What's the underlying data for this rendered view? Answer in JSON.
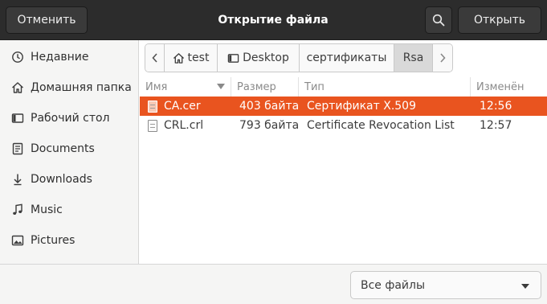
{
  "header": {
    "cancel_label": "Отменить",
    "title": "Открытие файла",
    "open_label": "Открыть",
    "search_icon": "search-icon"
  },
  "sidebar": {
    "items": [
      {
        "label": "Недавние",
        "icon": "clock-icon"
      },
      {
        "label": "Домашняя папка",
        "icon": "home-icon"
      },
      {
        "label": "Рабочий стол",
        "icon": "desktop-icon"
      },
      {
        "label": "Documents",
        "icon": "document-icon"
      },
      {
        "label": "Downloads",
        "icon": "download-icon"
      },
      {
        "label": "Music",
        "icon": "music-icon"
      },
      {
        "label": "Pictures",
        "icon": "picture-icon"
      }
    ]
  },
  "pathbar": {
    "crumbs": [
      {
        "label": "test",
        "icon": "home-icon"
      },
      {
        "label": "Desktop",
        "icon": "desktop-icon"
      },
      {
        "label": "сертификаты"
      },
      {
        "label": "Rsa",
        "active": true
      }
    ]
  },
  "list": {
    "columns": [
      "Имя",
      "Размер",
      "Тип",
      "Изменён"
    ],
    "rows": [
      {
        "name": "CA.cer",
        "size": "403 байта",
        "type": "Сертификат X.509",
        "modified": "12:56",
        "selected": true
      },
      {
        "name": "CRL.crl",
        "size": "793 байта",
        "type": "Certificate Revocation List",
        "modified": "12:57",
        "selected": false
      }
    ]
  },
  "filter": {
    "selected": "Все файлы"
  },
  "colors": {
    "header_bg": "#2c2c2c",
    "selection": "#e9541f",
    "sidebar_bg": "#f5f5f4"
  }
}
